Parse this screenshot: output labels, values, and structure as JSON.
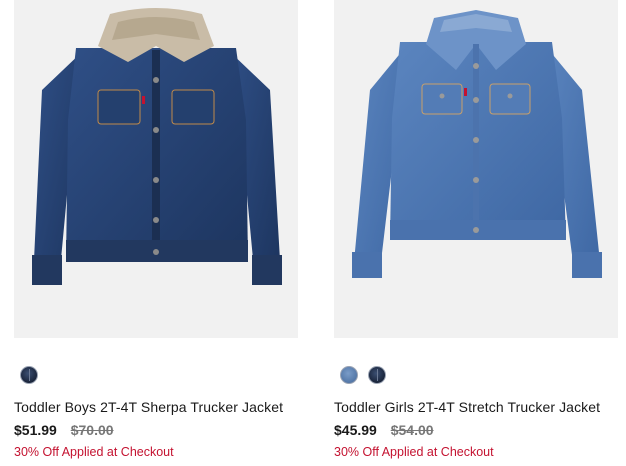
{
  "products": [
    {
      "name": "Toddler Boys 2T-4T Sherpa Trucker Jacket",
      "price": "$51.99",
      "original_price": "$70.00",
      "promo": "30% Off Applied at Checkout",
      "swatches": [
        "dark-indigo"
      ],
      "image": "dark denim sherpa-collar trucker jacket"
    },
    {
      "name": "Toddler Girls 2T-4T Stretch Trucker Jacket",
      "price": "$45.99",
      "original_price": "$54.00",
      "promo": "30% Off Applied at Checkout",
      "swatches": [
        "medium-blue",
        "dark-indigo"
      ],
      "image": "medium-wash denim trucker jacket"
    }
  ],
  "colors": {
    "sale_text": "#c41230",
    "image_bg": "#f1f1f1"
  }
}
